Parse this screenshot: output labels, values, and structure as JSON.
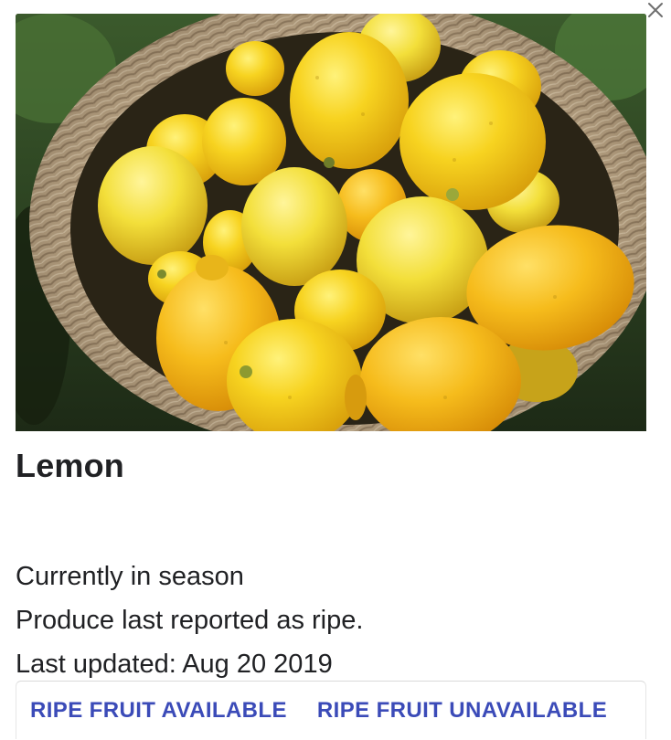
{
  "card": {
    "title": "Lemon",
    "season_status": "Currently in season",
    "ripeness_status": "Produce last reported as ripe.",
    "last_updated": "Last updated: Aug 20 2019"
  },
  "actions": {
    "available_label": "RIPE FRUIT AVAILABLE",
    "unavailable_label": "RIPE FRUIT UNAVAILABLE"
  },
  "icons": {
    "close": "close-icon"
  },
  "colors": {
    "action_text": "#3b4bb8",
    "title_text": "#202124"
  }
}
